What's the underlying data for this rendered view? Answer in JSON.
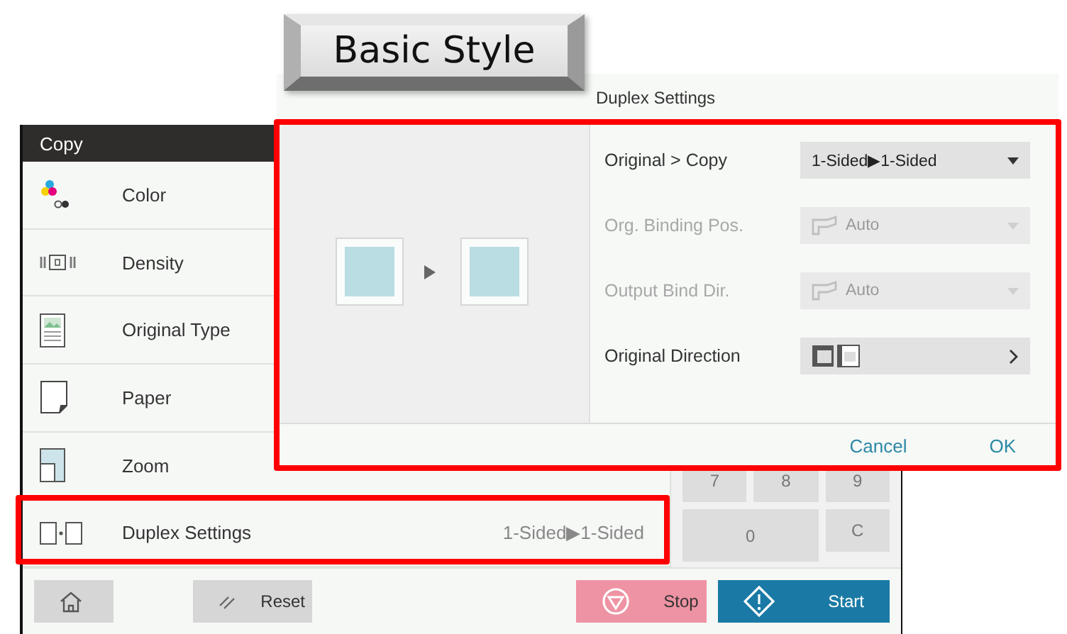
{
  "banner": {
    "label": "Basic Style"
  },
  "copy_screen": {
    "title": "Copy",
    "menu": [
      {
        "kind": "color",
        "label": "Color",
        "highlighted": false
      },
      {
        "kind": "density",
        "label": "Density",
        "highlighted": false
      },
      {
        "kind": "original_type",
        "label": "Original Type",
        "highlighted": false
      },
      {
        "kind": "paper",
        "label": "Paper",
        "highlighted": false
      },
      {
        "kind": "zoom",
        "label": "Zoom",
        "highlighted": false
      },
      {
        "kind": "duplex",
        "label": "Duplex Settings",
        "value": "1-Sided▶1-Sided",
        "highlighted": true
      }
    ],
    "keypad": [
      {
        "label": "7",
        "wide": false
      },
      {
        "label": "8",
        "wide": false
      },
      {
        "label": "9",
        "wide": false
      },
      {
        "label": "0",
        "wide": true
      },
      {
        "label": "C",
        "wide": false
      }
    ],
    "bottom_buttons": [
      {
        "kind": "home"
      },
      {
        "kind": "reset",
        "label": "Reset"
      },
      {
        "kind": "stop",
        "label": "Stop"
      },
      {
        "kind": "start",
        "label": "Start"
      }
    ]
  },
  "dialog": {
    "title": "Duplex Settings",
    "highlighted": true,
    "rows": [
      {
        "kind": "dropdown",
        "label": "Original > Copy",
        "value": "1-Sided▶1-Sided",
        "disabled": false
      },
      {
        "kind": "dropdown",
        "label": "Org. Binding Pos.",
        "value": "Auto",
        "disabled": true
      },
      {
        "kind": "dropdown",
        "label": "Output Bind Dir.",
        "value": "Auto",
        "disabled": true
      },
      {
        "kind": "direction",
        "label": "Original Direction",
        "disabled": false
      }
    ],
    "buttons": [
      "Cancel",
      "OK"
    ]
  }
}
